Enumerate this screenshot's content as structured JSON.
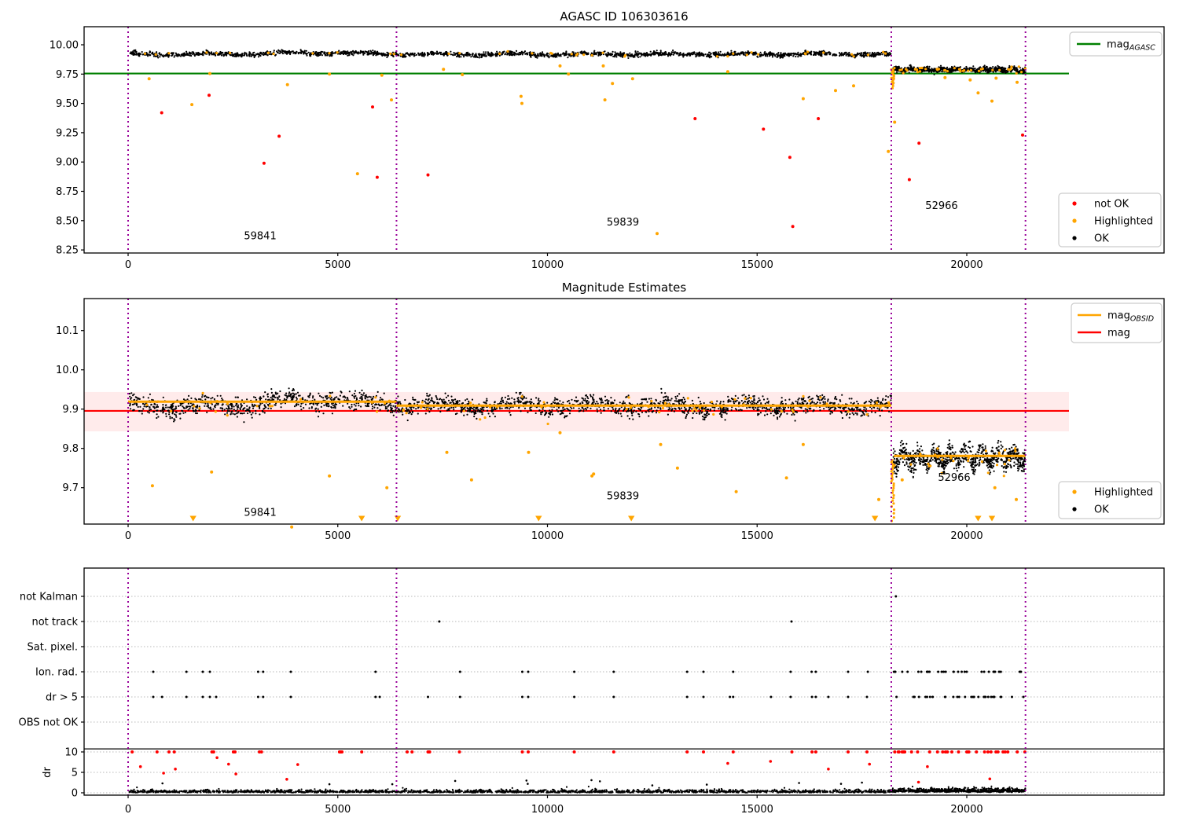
{
  "figure_title": "AGASC ID 106303616",
  "colors": {
    "ok": "#000000",
    "not_ok": "#ff0000",
    "highlighted": "#ffa500",
    "mag_agasc_line": "#008000",
    "mag_line": "#ff0000",
    "mag_obsid_line": "#ffa500",
    "obsid_boundary": "#990099",
    "grid": "#b8b8b8",
    "uncertainty_band": "rgba(255,0,0,0.08)",
    "frame": "#000000"
  },
  "chart_data": [
    {
      "name": "top",
      "type": "scatter",
      "title": "AGASC ID 106303616",
      "xticks": [
        0,
        5000,
        10000,
        15000,
        20000
      ],
      "xtick_labels": [
        "0",
        "5000",
        "10000",
        "15000",
        "20000"
      ],
      "ytick_values": [
        10.0,
        9.75,
        9.5,
        9.25,
        9.0,
        8.75,
        8.5,
        8.25
      ],
      "ytick_labels": [
        "10.00",
        "9.75",
        "9.50",
        "9.25",
        "9.00",
        "8.75",
        "8.50",
        "8.25"
      ],
      "mag_agasc": 9.755,
      "vlines": [
        0,
        6400,
        18200,
        21400
      ],
      "legend_line": {
        "label": "mag",
        "sub": "AGASC"
      },
      "legend_points": [
        {
          "label": "not OK",
          "color_key": "not_ok"
        },
        {
          "label": "Highlighted",
          "color_key": "highlighted"
        },
        {
          "label": "OK",
          "color_key": "ok"
        }
      ],
      "annotations": [
        {
          "text": "59841",
          "x": 3150,
          "y": 8.34
        },
        {
          "text": "59839",
          "x": 11800,
          "y": 8.46
        },
        {
          "text": "52966",
          "x": 19400,
          "y": 8.6
        }
      ],
      "bands": [
        {
          "x0": 30,
          "x1": 18200,
          "n": 2200,
          "mean": 9.92,
          "noise": 0.016,
          "w1": 0.007,
          "p1": 290,
          "w2": 0.004,
          "p2": 71,
          "bump": {
            "x0": 2600,
            "x1": 6400,
            "amp": 0.013
          },
          "orange_frac": 0.025
        },
        {
          "x0": 18240,
          "x1": 21400,
          "n": 820,
          "mean": 9.787,
          "noise": 0.02,
          "w1": 0.006,
          "p1": 55,
          "w2": 0.003,
          "p2": 23,
          "orange_frac": 0.05
        }
      ],
      "orange_streak": {
        "x": 18220,
        "y0": 9.63,
        "y1": 9.79,
        "n": 20,
        "jx": 70
      },
      "red_points": [
        [
          800,
          9.42
        ],
        [
          1930,
          9.57
        ],
        [
          3240,
          8.99
        ],
        [
          3600,
          9.22
        ],
        [
          5830,
          9.47
        ],
        [
          5940,
          8.87
        ],
        [
          7150,
          8.89
        ],
        [
          13520,
          9.37
        ],
        [
          15150,
          9.28
        ],
        [
          15780,
          9.04
        ],
        [
          15850,
          8.45
        ],
        [
          16460,
          9.37
        ],
        [
          18630,
          8.85
        ],
        [
          18860,
          9.16
        ],
        [
          21330,
          9.23
        ]
      ],
      "orange_points": [
        [
          500,
          9.71
        ],
        [
          1520,
          9.49
        ],
        [
          1950,
          9.755
        ],
        [
          3800,
          9.66
        ],
        [
          4800,
          9.75
        ],
        [
          5470,
          8.9
        ],
        [
          6050,
          9.74
        ],
        [
          6280,
          9.53
        ],
        [
          7520,
          9.79
        ],
        [
          7970,
          9.745
        ],
        [
          9370,
          9.56
        ],
        [
          9390,
          9.5
        ],
        [
          10300,
          9.82
        ],
        [
          10500,
          9.75
        ],
        [
          11330,
          9.82
        ],
        [
          11370,
          9.53
        ],
        [
          11550,
          9.67
        ],
        [
          12030,
          9.71
        ],
        [
          12615,
          8.39
        ],
        [
          14300,
          9.77
        ],
        [
          16100,
          9.54
        ],
        [
          16870,
          9.61
        ],
        [
          17300,
          9.65
        ],
        [
          18130,
          9.09
        ],
        [
          18280,
          9.34
        ],
        [
          19480,
          9.72
        ],
        [
          20080,
          9.7
        ],
        [
          20270,
          9.59
        ],
        [
          20600,
          9.52
        ],
        [
          20700,
          9.715
        ],
        [
          21200,
          9.68
        ]
      ]
    },
    {
      "name": "middle",
      "type": "scatter",
      "title": "Magnitude Estimates",
      "xticks": [
        0,
        5000,
        10000,
        15000,
        20000
      ],
      "xtick_labels": [
        "0",
        "5000",
        "10000",
        "15000",
        "20000"
      ],
      "ytick_values": [
        10.1,
        10.0,
        9.9,
        9.8,
        9.7
      ],
      "ytick_labels": [
        "10.1",
        "10.0",
        "9.9",
        "9.8",
        "9.7"
      ],
      "mag": 9.8955,
      "uncertainty_band": [
        9.8435,
        9.9435
      ],
      "vlines": [
        0,
        6400,
        18200,
        21400
      ],
      "legend_lines": [
        {
          "label": "mag",
          "sub": "OBSID",
          "color_key": "mag_obsid_line"
        },
        {
          "label": "mag",
          "sub": "",
          "color_key": "mag_line"
        }
      ],
      "legend_points": [
        {
          "label": "Highlighted",
          "color_key": "highlighted"
        },
        {
          "label": "OK",
          "color_key": "ok"
        }
      ],
      "annotations": [
        {
          "text": "59841",
          "x": 3150,
          "y": 9.628
        },
        {
          "text": "59839",
          "x": 11800,
          "y": 9.67
        },
        {
          "text": "52966",
          "x": 19700,
          "y": 9.717
        }
      ],
      "mag_obsid_segments": [
        [
          0,
          6400,
          9.919
        ],
        [
          6400,
          18200,
          9.909
        ],
        [
          18260,
          21400,
          9.781
        ]
      ],
      "bands": [
        {
          "x0": 30,
          "x1": 18200,
          "n": 2400,
          "mean": 9.908,
          "noise": 0.019,
          "w1": 0.008,
          "p1": 290,
          "w2": 0.005,
          "p2": 67,
          "bump": {
            "x0": 2600,
            "x1": 6400,
            "amp": 0.02
          },
          "orange_frac": 0.03
        },
        {
          "x0": 18240,
          "x1": 21400,
          "n": 880,
          "mean": 9.775,
          "noise": 0.024,
          "w1": 0.012,
          "p1": 60,
          "w2": 0.005,
          "p2": 29,
          "orange_frac": 0.03
        }
      ],
      "orange_streak": {
        "x": 18220,
        "y0": 9.607,
        "y1": 9.77,
        "n": 26,
        "jx": 70
      },
      "orange_points": [
        [
          580,
          9.705
        ],
        [
          1990,
          9.74
        ],
        [
          3900,
          9.6
        ],
        [
          4800,
          9.73
        ],
        [
          6170,
          9.7
        ],
        [
          7600,
          9.79
        ],
        [
          8190,
          9.72
        ],
        [
          9550,
          9.79
        ],
        [
          10300,
          9.84
        ],
        [
          11060,
          9.73
        ],
        [
          11100,
          9.735
        ],
        [
          12700,
          9.81
        ],
        [
          13100,
          9.75
        ],
        [
          14500,
          9.69
        ],
        [
          15700,
          9.725
        ],
        [
          16100,
          9.81
        ],
        [
          17900,
          9.67
        ],
        [
          18460,
          9.72
        ],
        [
          20670,
          9.7
        ],
        [
          21180,
          9.67
        ]
      ],
      "clip_triangles_x": [
        1550,
        5570,
        6430,
        9790,
        12000,
        17810,
        20270,
        20600
      ]
    },
    {
      "name": "bottom",
      "type": "scatter",
      "title": "",
      "xticks": [
        0,
        5000,
        10000,
        15000,
        20000
      ],
      "xtick_labels": [
        "0",
        "5000",
        "10000",
        "15000",
        "20000"
      ],
      "categories": [
        "not Kalman",
        "not track",
        "Sat. pixel.",
        "Ion. rad.",
        "dr > 5",
        "OBS not OK"
      ],
      "dr_ticks": [
        10,
        5,
        0
      ],
      "dr_label": "dr",
      "dr_threshold_line": 10.75,
      "vlines": [
        0,
        6400,
        18200,
        21400
      ],
      "flags": {
        "not_kalman": [
          18310
        ],
        "not_track": [
          7420,
          15820
        ],
        "sat_pixel": [],
        "ion_rad": [
          600,
          1390,
          1780,
          1950,
          3100,
          3220,
          3880,
          5900,
          7915,
          9400,
          9540,
          10640,
          11580,
          13330,
          13720,
          14430,
          15800,
          16300,
          16400,
          17170,
          17640
        ],
        "ion_rad_cluster": {
          "from": 18260,
          "to": 21380,
          "n": 30
        },
        "dr5": [
          600,
          810,
          1390,
          1780,
          1950,
          2100,
          3100,
          3220,
          3880,
          5900,
          6000,
          7150,
          7915,
          9400,
          9540,
          10640,
          11580,
          13330,
          13720,
          14350,
          14430,
          15330,
          15800,
          16310,
          16400,
          16700,
          17170,
          17620
        ],
        "dr5_cluster": {
          "from": 18260,
          "to": 21380,
          "n": 32
        },
        "obs_not_ok": []
      },
      "red_clipped_dr10_x": [
        95,
        690,
        975,
        1100,
        2000,
        2040,
        2510,
        2550,
        3130,
        3180,
        5040,
        5070,
        5100,
        5570,
        6655,
        6770,
        7150,
        7170,
        7190,
        7900,
        9400,
        9540,
        10640,
        11580,
        13330,
        13720,
        14430,
        15830,
        16310,
        16400,
        17170,
        17620
      ],
      "red_clipped_cluster": {
        "from": 18250,
        "to": 21390,
        "n": 30
      },
      "red_mid_points": [
        [
          295,
          6.4
        ],
        [
          845,
          4.8
        ],
        [
          1127,
          5.8
        ],
        [
          2120,
          8.6
        ],
        [
          2395,
          7.0
        ],
        [
          2570,
          4.6
        ],
        [
          3785,
          3.3
        ],
        [
          4045,
          6.9
        ],
        [
          14300,
          7.2
        ],
        [
          15320,
          7.7
        ],
        [
          16700,
          5.8
        ],
        [
          17680,
          7.0
        ],
        [
          19060,
          6.4
        ],
        [
          18850,
          2.6
        ],
        [
          20550,
          3.4
        ]
      ],
      "black_spike_points": [
        [
          820,
          2.3
        ],
        [
          4800,
          2.1
        ],
        [
          6300,
          2.1
        ],
        [
          7800,
          2.9
        ],
        [
          9500,
          3.0
        ],
        [
          9530,
          2.2
        ],
        [
          11050,
          3.1
        ],
        [
          11250,
          2.8
        ],
        [
          12500,
          1.8
        ],
        [
          13800,
          2.0
        ],
        [
          16000,
          2.4
        ],
        [
          17000,
          2.2
        ],
        [
          17500,
          2.5
        ]
      ],
      "dr_bands": [
        {
          "x0": 30,
          "x1": 18200,
          "n": 2000,
          "base": 0.07,
          "amp": 1.0
        },
        {
          "x0": 18200,
          "x1": 21400,
          "n": 760,
          "base": 0.2,
          "amp": 1.45
        }
      ]
    }
  ]
}
